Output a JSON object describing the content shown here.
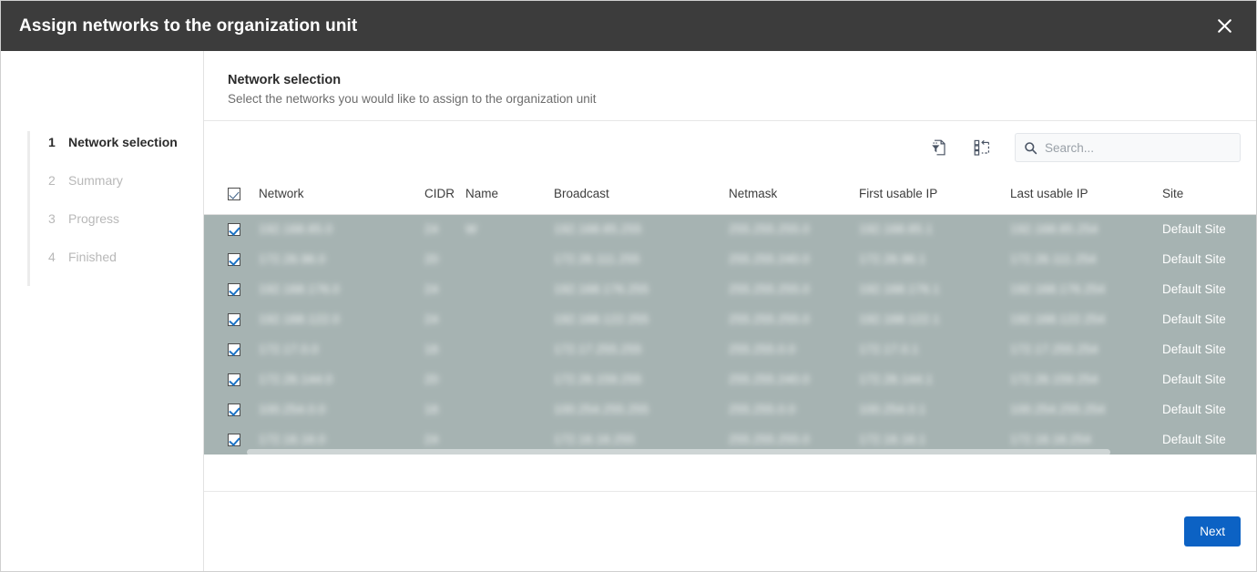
{
  "window": {
    "title": "Assign networks to the organization unit",
    "close_icon": "close-icon"
  },
  "sidebar": {
    "steps": [
      {
        "num": "1",
        "label": "Network selection",
        "state": "active"
      },
      {
        "num": "2",
        "label": "Summary",
        "state": "inactive"
      },
      {
        "num": "3",
        "label": "Progress",
        "state": "inactive"
      },
      {
        "num": "4",
        "label": "Finished",
        "state": "inactive"
      }
    ]
  },
  "content": {
    "title": "Network selection",
    "subtitle": "Select the networks you would like to assign to the organization unit"
  },
  "toolbar": {
    "filter_icon": "document-filter-icon",
    "selection_icon": "list-selection-icon",
    "search": {
      "icon": "search-icon",
      "placeholder": "Search...",
      "value": ""
    }
  },
  "table": {
    "select_all_checked": true,
    "columns": [
      "Network",
      "CIDR",
      "Name",
      "Broadcast",
      "Netmask",
      "First usable IP",
      "Last usable IP",
      "Site"
    ],
    "rows": [
      {
        "checked": true,
        "network": "192.168.85.0",
        "cidr": "24",
        "name": "W",
        "broadcast": "192.168.85.255",
        "netmask": "255.255.255.0",
        "first_usable_ip": "192.168.85.1",
        "last_usable_ip": "192.168.85.254",
        "site": "Default Site"
      },
      {
        "checked": true,
        "network": "172.26.96.0",
        "cidr": "20",
        "name": "",
        "broadcast": "172.26.111.255",
        "netmask": "255.255.240.0",
        "first_usable_ip": "172.26.96.1",
        "last_usable_ip": "172.26.111.254",
        "site": "Default Site"
      },
      {
        "checked": true,
        "network": "192.168.176.0",
        "cidr": "24",
        "name": "",
        "broadcast": "192.168.176.255",
        "netmask": "255.255.255.0",
        "first_usable_ip": "192.168.176.1",
        "last_usable_ip": "192.168.176.254",
        "site": "Default Site"
      },
      {
        "checked": true,
        "network": "192.168.122.0",
        "cidr": "24",
        "name": "",
        "broadcast": "192.168.122.255",
        "netmask": "255.255.255.0",
        "first_usable_ip": "192.168.122.1",
        "last_usable_ip": "192.168.122.254",
        "site": "Default Site"
      },
      {
        "checked": true,
        "network": "172.17.0.0",
        "cidr": "16",
        "name": "",
        "broadcast": "172.17.255.255",
        "netmask": "255.255.0.0",
        "first_usable_ip": "172.17.0.1",
        "last_usable_ip": "172.17.255.254",
        "site": "Default Site"
      },
      {
        "checked": true,
        "network": "172.26.144.0",
        "cidr": "20",
        "name": "",
        "broadcast": "172.26.159.255",
        "netmask": "255.255.240.0",
        "first_usable_ip": "172.26.144.1",
        "last_usable_ip": "172.26.159.254",
        "site": "Default Site"
      },
      {
        "checked": true,
        "network": "100.254.0.0",
        "cidr": "16",
        "name": "",
        "broadcast": "100.254.255.255",
        "netmask": "255.255.0.0",
        "first_usable_ip": "100.254.0.1",
        "last_usable_ip": "100.254.255.254",
        "site": "Default Site"
      },
      {
        "checked": true,
        "network": "172.16.16.0",
        "cidr": "24",
        "name": "",
        "broadcast": "172.16.16.255",
        "netmask": "255.255.255.0",
        "first_usable_ip": "172.16.16.1",
        "last_usable_ip": "172.16.16.254",
        "site": "Default Site"
      }
    ]
  },
  "footer": {
    "next_label": "Next"
  },
  "colors": {
    "titlebar": "#3c3c3c",
    "primary_button": "#0c62c4",
    "selected_row": "#a6b3b2",
    "active_step_text": "#2b2b2b",
    "inactive_step_text": "#b8b8b8"
  }
}
